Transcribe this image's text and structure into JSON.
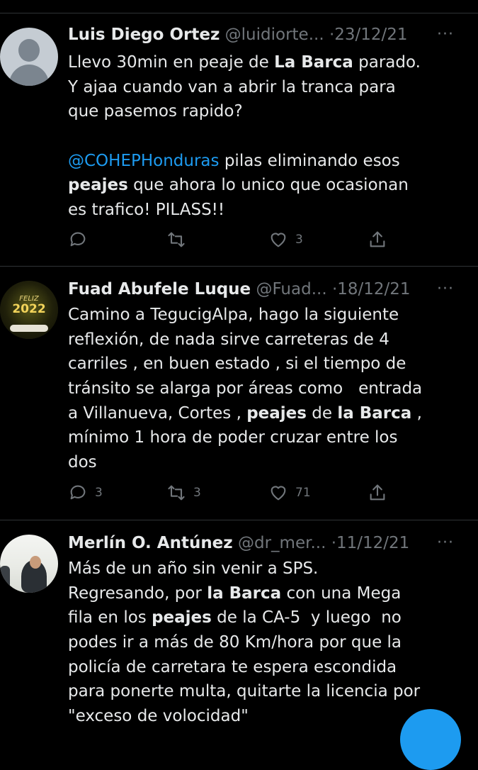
{
  "tweets": [
    {
      "name": "Luis Diego Ortez",
      "handle": "@luidiorte...",
      "dot": "·",
      "date": "23/12/21",
      "more": "···",
      "lines": [
        [
          "Llevo 30min en peaje de ",
          {
            "b": "La Barca"
          },
          " parado."
        ],
        [
          "Y ajaa cuando van a abrir la tranca para"
        ],
        [
          "que pasemos rapido?"
        ],
        [],
        [
          {
            "m": "@COHEPHonduras"
          },
          " pilas eliminando esos"
        ],
        [
          {
            "b": "peajes"
          },
          " que ahora lo unico que ocasionan"
        ],
        [
          "es trafico! PILASS!!"
        ]
      ],
      "counts": {
        "reply": "",
        "retweet": "",
        "like": "3"
      }
    },
    {
      "name": "Fuad Abufele Luque",
      "handle": "@Fuad...",
      "dot": "·",
      "date": "18/12/21",
      "more": "···",
      "avatar_text": {
        "feliz": "FELIZ",
        "year": "2022"
      },
      "lines": [
        [
          "Camino a TegucigAlpa, hago la siguiente"
        ],
        [
          "reflexión, de nada sirve carreteras de 4"
        ],
        [
          "carriles , en buen estado , si el tiempo de"
        ],
        [
          "tránsito se alarga por áreas como   entrada"
        ],
        [
          "a Villanueva, Cortes , ",
          {
            "b": "peajes"
          },
          " de ",
          {
            "b": "la Barca"
          },
          " ,"
        ],
        [
          "mínimo 1 hora de poder cruzar entre los"
        ],
        [
          "dos"
        ]
      ],
      "counts": {
        "reply": "3",
        "retweet": "3",
        "like": "71"
      }
    },
    {
      "name": "Merlín O. Antúnez",
      "handle": "@dr_mer...",
      "dot": "·",
      "date": "11/12/21",
      "more": "···",
      "lines": [
        [
          "Más de un año sin venir a SPS."
        ],
        [
          "Regresando, por ",
          {
            "b": "la Barca"
          },
          " con una Mega"
        ],
        [
          "fila en los ",
          {
            "b": "peajes"
          },
          " de la CA-5  y luego  no"
        ],
        [
          "podes ir a más de 80 Km/hora por que la"
        ],
        [
          "policía de carretara te espera escondida"
        ],
        [
          "para ponerte multa, quitarte la licencia por"
        ],
        [
          "\"exceso de volocidad\""
        ]
      ],
      "counts": {}
    }
  ],
  "icons": [
    "reply-icon",
    "retweet-icon",
    "like-icon",
    "share-icon",
    "more-icon",
    "compose-fab"
  ],
  "colors": {
    "background": "#000000",
    "text": "#e7e9ea",
    "muted": "#71767b",
    "mention": "#1d9bf0",
    "border": "#2f3336"
  }
}
